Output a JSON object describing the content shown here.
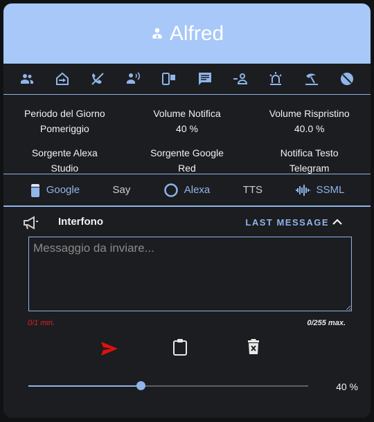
{
  "header": {
    "title": "Alfred",
    "icon": "account-icon"
  },
  "icon_row": [
    {
      "name": "group-icon"
    },
    {
      "name": "home-import-icon"
    },
    {
      "name": "phone-missed-icon"
    },
    {
      "name": "account-voice-icon"
    },
    {
      "name": "devices-icon"
    },
    {
      "name": "message-text-icon"
    },
    {
      "name": "account-arrow-icon"
    },
    {
      "name": "alarm-light-icon"
    },
    {
      "name": "beach-icon"
    },
    {
      "name": "do-not-disturb-icon"
    }
  ],
  "info": [
    [
      {
        "label": "Periodo del Giorno",
        "value": "Pomeriggio"
      },
      {
        "label": "Volume Notifica",
        "value": "40 %"
      },
      {
        "label": "Volume Rispristino",
        "value": "40.0 %"
      }
    ],
    [
      {
        "label": "Sorgente Alexa",
        "value": "Studio"
      },
      {
        "label": "Sorgente Google",
        "value": "Red"
      },
      {
        "label": "Notifica Testo",
        "value": "Telegram"
      }
    ]
  ],
  "tabs": {
    "google": "Google",
    "say": "Say",
    "alexa": "Alexa",
    "tts": "TTS",
    "ssml": "SSML"
  },
  "section": {
    "title": "Interfono",
    "last_message": "LAST MESSAGE",
    "placeholder": "Messaggio da inviare...",
    "count_min": "0/1 min.",
    "count_max": "0/255 max."
  },
  "slider": {
    "value_label": "40 %",
    "value": 40
  },
  "colors": {
    "accent": "#8fb5ea",
    "header": "#a7c8f8",
    "send": "#e01010",
    "error": "#e02020"
  }
}
